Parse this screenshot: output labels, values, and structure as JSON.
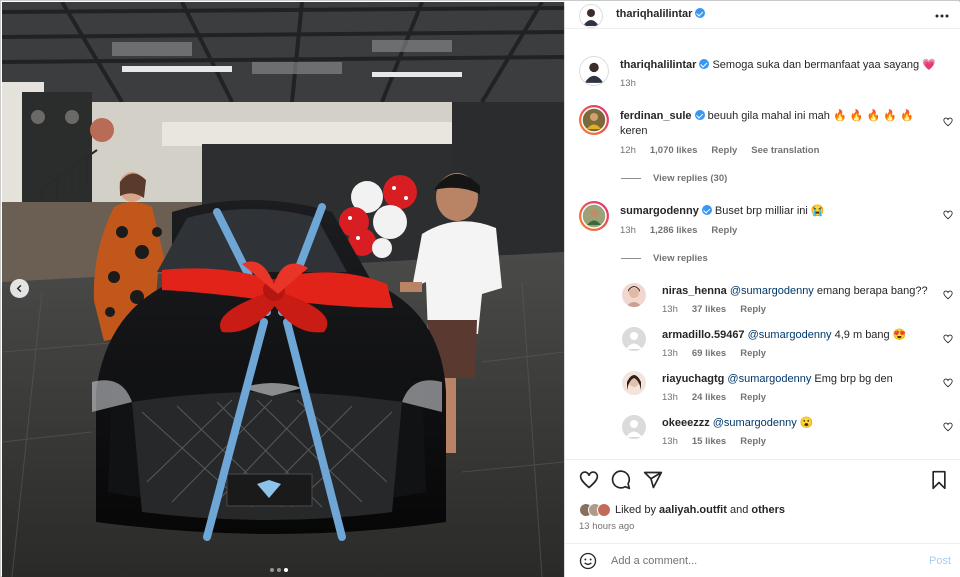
{
  "post": {
    "username": "thariqhalilintar",
    "more_icon": "more-horizontal-icon",
    "caption": {
      "username": "thariqhalilintar",
      "text": "Semoga suka dan bermanfaat yaa sayang 💗",
      "time": "13h"
    },
    "comments": [
      {
        "username": "ferdinan_sule",
        "text_line1": "beuuh gila mahal ini mah 🔥 🔥 🔥 🔥 🔥",
        "text_line2": "keren",
        "time": "12h",
        "likes": "1,070 likes",
        "reply": "Reply",
        "translation": "See translation",
        "view_replies": "View replies (30)"
      },
      {
        "username": "sumargodenny",
        "text": "Buset brp milliar ini 😭",
        "time": "13h",
        "likes": "1,286 likes",
        "reply": "Reply",
        "view_replies": "View replies",
        "replies": [
          {
            "username": "niras_henna",
            "mention": "@sumargodenny",
            "text": "emang berapa bang??",
            "time": "13h",
            "likes": "37 likes",
            "reply": "Reply"
          },
          {
            "username": "armadillo.59467",
            "mention": "@sumargodenny",
            "text": "4,9 m bang 😍",
            "time": "13h",
            "likes": "69 likes",
            "reply": "Reply"
          },
          {
            "username": "riayuchagtg",
            "mention": "@sumargodenny",
            "text": "Emg brp bg den",
            "time": "13h",
            "likes": "24 likes",
            "reply": "Reply"
          },
          {
            "username": "okeeezzz",
            "mention": "@sumargodenny",
            "text": "😮",
            "time": "13h",
            "likes": "15 likes",
            "reply": "Reply"
          }
        ]
      }
    ],
    "liked_by": {
      "prefix": "Liked by",
      "user": "aaliyah.outfit",
      "and": "and",
      "others": "others"
    },
    "time_ago": "13 hours ago",
    "add_comment": {
      "placeholder": "Add a comment...",
      "post_label": "Post"
    }
  },
  "colors": {
    "verified": "#3897f0",
    "link": "#00376b",
    "post_disabled": "#a7cdf5",
    "ribbon_red": "#e2231a",
    "ribbon_blue": "#6ea6d6"
  }
}
